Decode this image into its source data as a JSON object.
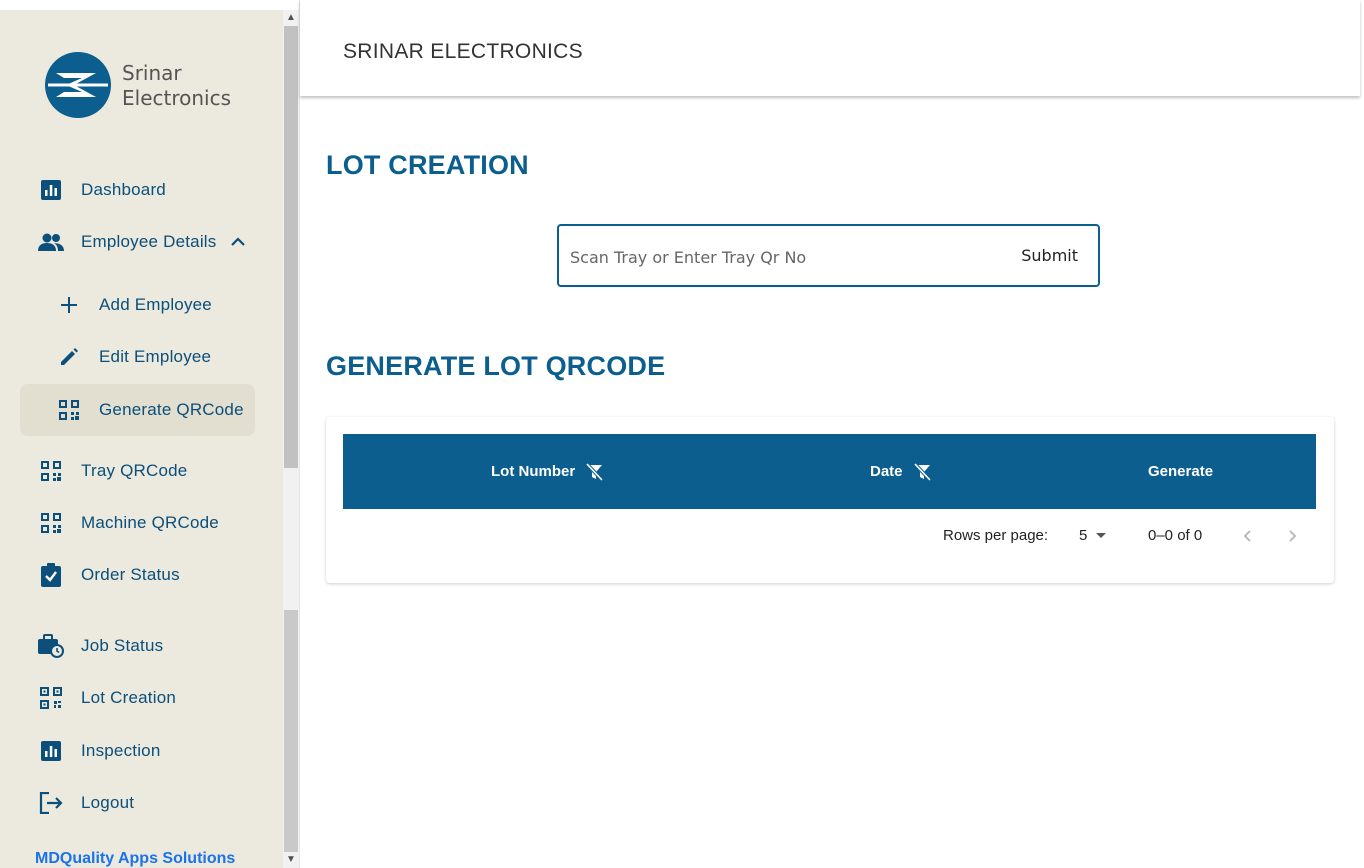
{
  "sidebar": {
    "logo": {
      "line1": "Srinar",
      "line2": "Electronics"
    },
    "items": [
      {
        "label": "Dashboard",
        "icon": "bar-chart-icon"
      },
      {
        "label": "Employee Details",
        "icon": "people-icon"
      },
      {
        "label": "Add Employee",
        "icon": "plus-icon"
      },
      {
        "label": "Edit Employee",
        "icon": "pencil-icon"
      },
      {
        "label": "Generate QRCode",
        "icon": "qrcode-icon"
      },
      {
        "label": "Tray QRCode",
        "icon": "qrcode-icon"
      },
      {
        "label": "Machine QRCode",
        "icon": "qrcode-icon"
      },
      {
        "label": "Order Status",
        "icon": "clipboard-check-icon"
      },
      {
        "label": "Job Status",
        "icon": "briefcase-clock-icon"
      },
      {
        "label": "Lot Creation",
        "icon": "qr-scan-icon"
      },
      {
        "label": "Inspection",
        "icon": "bar-chart-icon"
      },
      {
        "label": "Logout",
        "icon": "logout-icon"
      }
    ],
    "footer": "MDQuality Apps Solutions"
  },
  "header": {
    "title": "SRINAR ELECTRONICS"
  },
  "main": {
    "lot_creation_title": "LOT CREATION",
    "scan": {
      "placeholder": "Scan Tray or Enter Tray Qr No",
      "submit_label": "Submit"
    },
    "generate_title": "GENERATE LOT QRCODE",
    "table": {
      "columns": [
        "Lot Number",
        "Date",
        "Generate"
      ],
      "rows_per_page_label": "Rows per page:",
      "rows_per_page_value": "5",
      "range_text": "0–0 of 0"
    }
  },
  "colors": {
    "accent": "#0b5e8e",
    "sidebar_bg": "#ece9de",
    "link": "#1a73e8"
  }
}
